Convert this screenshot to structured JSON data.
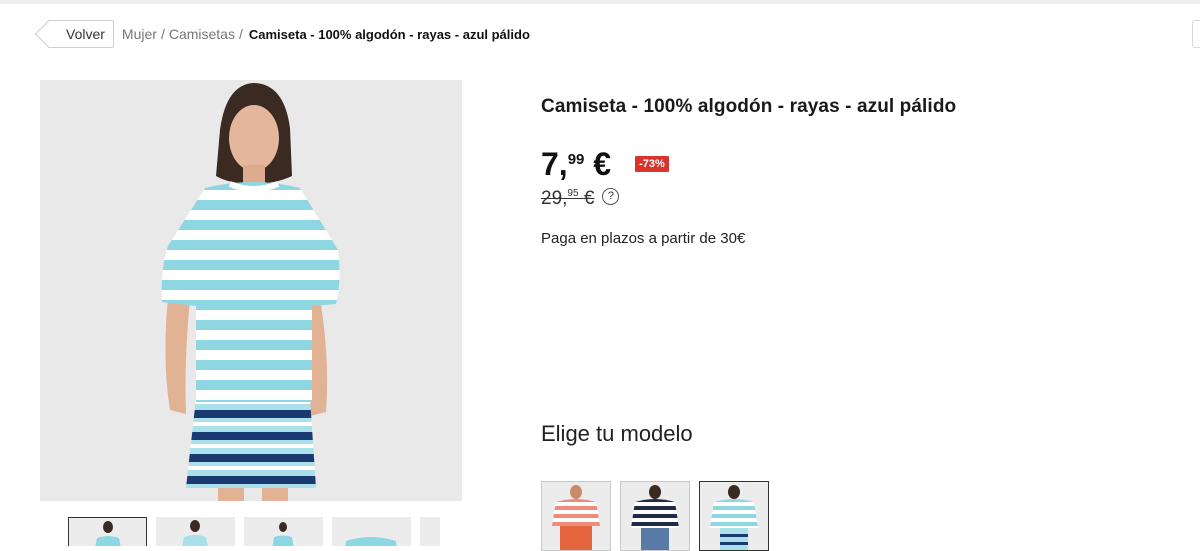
{
  "breadcrumb": {
    "back_label": "Volver",
    "items": [
      "Mujer",
      "Camisetas"
    ],
    "separator": "/",
    "current": "Camiseta - 100% algodón - rayas - azul pálido"
  },
  "product": {
    "title": "Camiseta - 100% algodón - rayas - azul pálido",
    "price_int": "7,",
    "price_dec": "99",
    "price_currency": "€",
    "discount": "-73%",
    "old_price_int": "29,",
    "old_price_dec": "95",
    "old_price_currency": "€",
    "help_symbol": "?",
    "installments": "Paga en plazos a partir de 30€"
  },
  "models": {
    "heading": "Elige tu modelo",
    "items": [
      {
        "name": "coral-stripes",
        "color": "#f08a7a"
      },
      {
        "name": "navy-stripes",
        "color": "#1f2a44"
      },
      {
        "name": "light-blue-stripes",
        "color": "#8fd6e3",
        "selected": true
      }
    ]
  },
  "colors": {
    "discount_badge": "#d9342b",
    "image_background": "#e9e9e9",
    "stripe_blue": "#8fd6e3",
    "skirt_navy": "#1c3a72"
  }
}
